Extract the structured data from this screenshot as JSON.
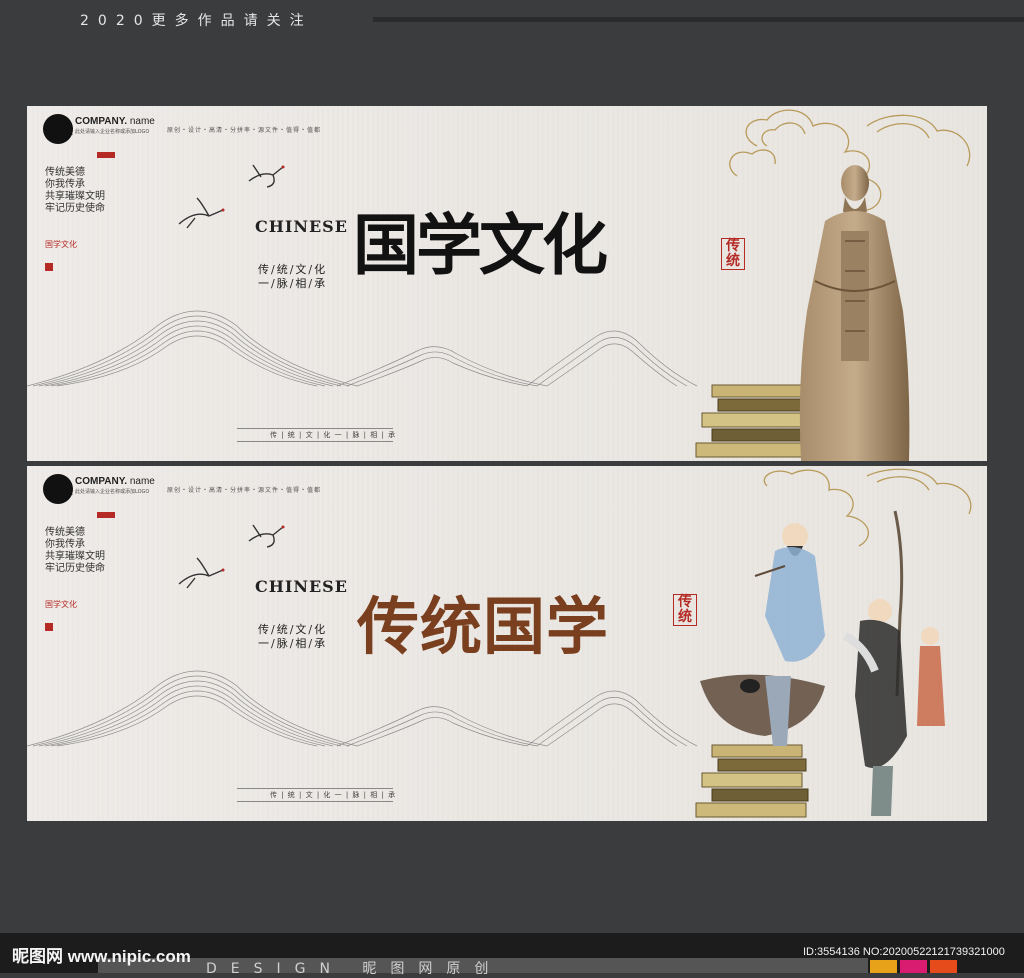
{
  "header": {
    "promo": "2020更多作品请关注"
  },
  "banners": [
    {
      "company": "COMPANY.",
      "company_name": "name",
      "company_sub": "此处请输入企业名称或添加LOGO",
      "nav": "原创・设计・高清・分拼率・源文件・值得・值都",
      "slogans": [
        "传统美德",
        "你我传承",
        "共享璀璨文明",
        "牢记历史使命"
      ],
      "sub_red": "国学文化",
      "chinese": "CHINESE",
      "sub_line1": "传/统/文/化",
      "sub_line2": "一/脉/相/承",
      "title": "国学文化",
      "seal": "传统",
      "scroll": "传 | 统 | 文 | 化  一 | 脉 | 相 | 承"
    },
    {
      "company": "COMPANY.",
      "company_name": "name",
      "company_sub": "此处请输入企业名称或添加LOGO",
      "nav": "原创・设计・高清・分拼率・源文件・值得・值都",
      "slogans": [
        "传统美德",
        "你我传承",
        "共享璀璨文明",
        "牢记历史使命"
      ],
      "sub_red": "国学文化",
      "chinese": "CHINESE",
      "sub_line1": "传/统/文/化",
      "sub_line2": "一/脉/相/承",
      "title": "传统国学",
      "seal": "传统",
      "scroll": "传 | 统 | 文 | 化  一 | 脉 | 相 | 承"
    }
  ],
  "footer": {
    "watermark": "昵图网 www.nipic.com",
    "design": "DESIGN 昵图网原创",
    "id": "ID:3554136 NO:20200522121739321000"
  },
  "colors": {
    "accent_red": "#b52a24",
    "title_brown": "#7a3f1e",
    "frame": "#3b3c3e",
    "cloud_gold": "#b89a5a"
  }
}
